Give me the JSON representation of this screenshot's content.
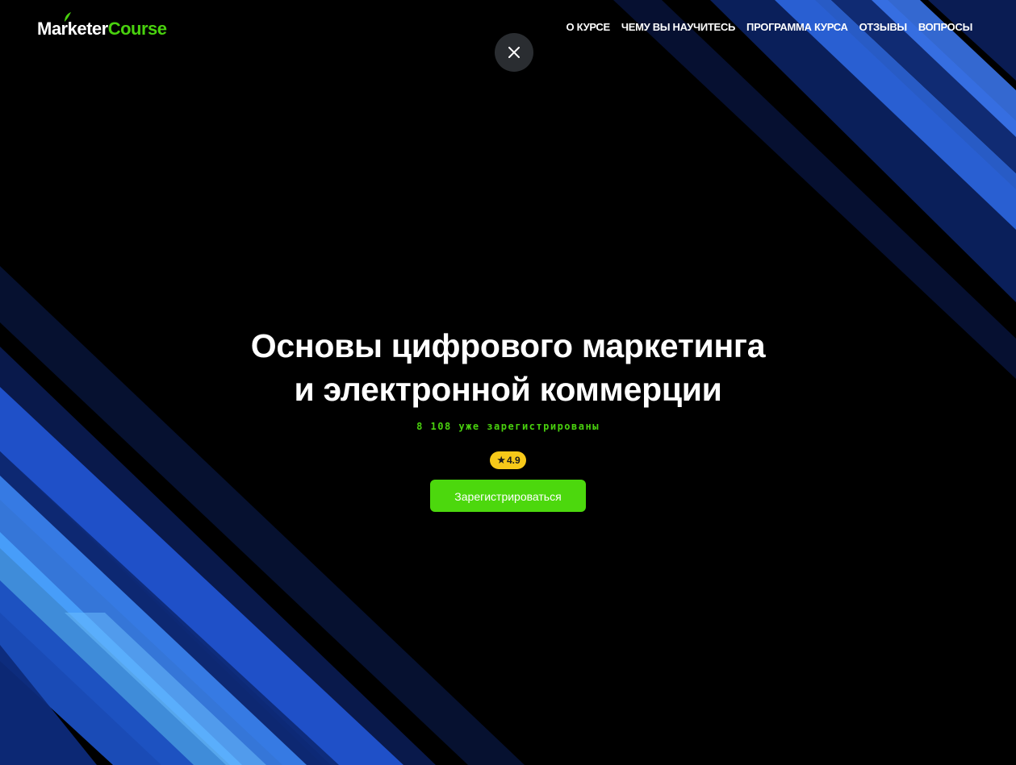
{
  "header": {
    "logo_part1": "Marketer",
    "logo_part2": "Course",
    "nav": [
      {
        "label": "О КУРСЕ"
      },
      {
        "label": "ЧЕМУ ВЫ НАУЧИТЕСЬ"
      },
      {
        "label": "ПРОГРАММА КУРСА"
      },
      {
        "label": "ОТЗЫВЫ"
      },
      {
        "label": "ВОПРОСЫ"
      }
    ],
    "close_icon": "close-icon"
  },
  "hero": {
    "title": "Основы цифрового маркетинга и электронной коммерции",
    "registered": "8 108 уже зарегистрированы",
    "rating_icon": "star-icon",
    "rating": "4.9",
    "cta_label": "Зарегистрироваться"
  },
  "colors": {
    "accent_green": "#49d10e",
    "rating_yellow": "#f7c919",
    "background": "#000000",
    "stripe_blue": "#1f5fd6"
  }
}
